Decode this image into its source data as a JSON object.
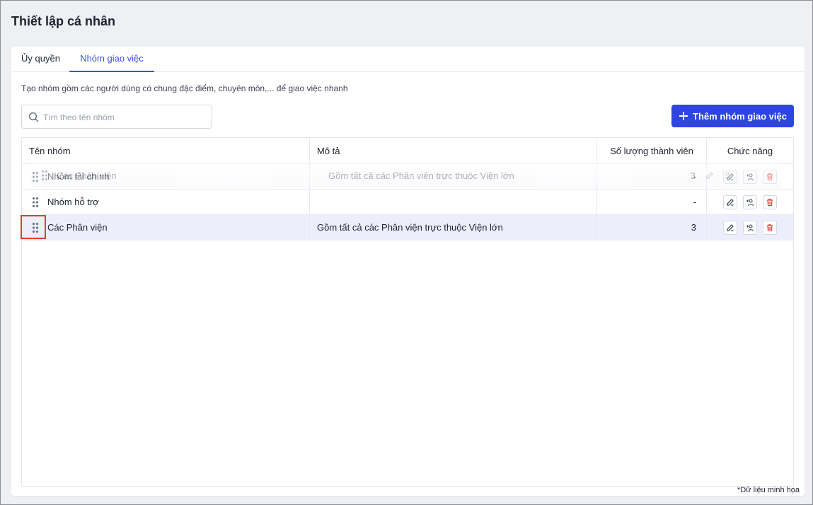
{
  "page": {
    "title": "Thiết lập cá nhân",
    "footnote": "*Dữ liệu minh họa"
  },
  "tabs": [
    {
      "label": "Ủy quyền",
      "active": false
    },
    {
      "label": "Nhóm giao việc",
      "active": true
    }
  ],
  "description": "Tạo nhóm gồm các người dùng có chung đặc điểm, chuyên môn,... để giao việc nhanh",
  "search": {
    "placeholder": "Tìm theo tên nhóm",
    "value": ""
  },
  "add_button": {
    "label": "Thêm nhóm giao việc"
  },
  "table": {
    "columns": [
      "Tên nhóm",
      "Mô tả",
      "Số lượng thành viên",
      "Chức năng"
    ],
    "rows": [
      {
        "name": "Nhóm tài chính",
        "description": "",
        "count": "-"
      },
      {
        "name": "Nhóm hỗ trợ",
        "description": "",
        "count": "-"
      },
      {
        "name": "Các Phân viện",
        "description": "Gồm tất cả các Phân viện trực thuộc Viện lớn",
        "count": "3"
      }
    ],
    "dragging_row": {
      "name": "Các Phân viện",
      "description": "Gồm tất cả các Phân viện trực thuộc Viện lớn",
      "count": "3"
    }
  },
  "icons": {
    "search": "search-icon",
    "add": "plus-icon",
    "drag": "drag-handle-icon",
    "edit": "edit-icon",
    "members": "add-member-icon",
    "delete": "trash-icon"
  },
  "colors": {
    "accent": "#2f45e0",
    "active_tab": "#3b4fe0",
    "selected_row": "#eceefb",
    "delete": "#e53935",
    "highlight": "#e53935"
  }
}
